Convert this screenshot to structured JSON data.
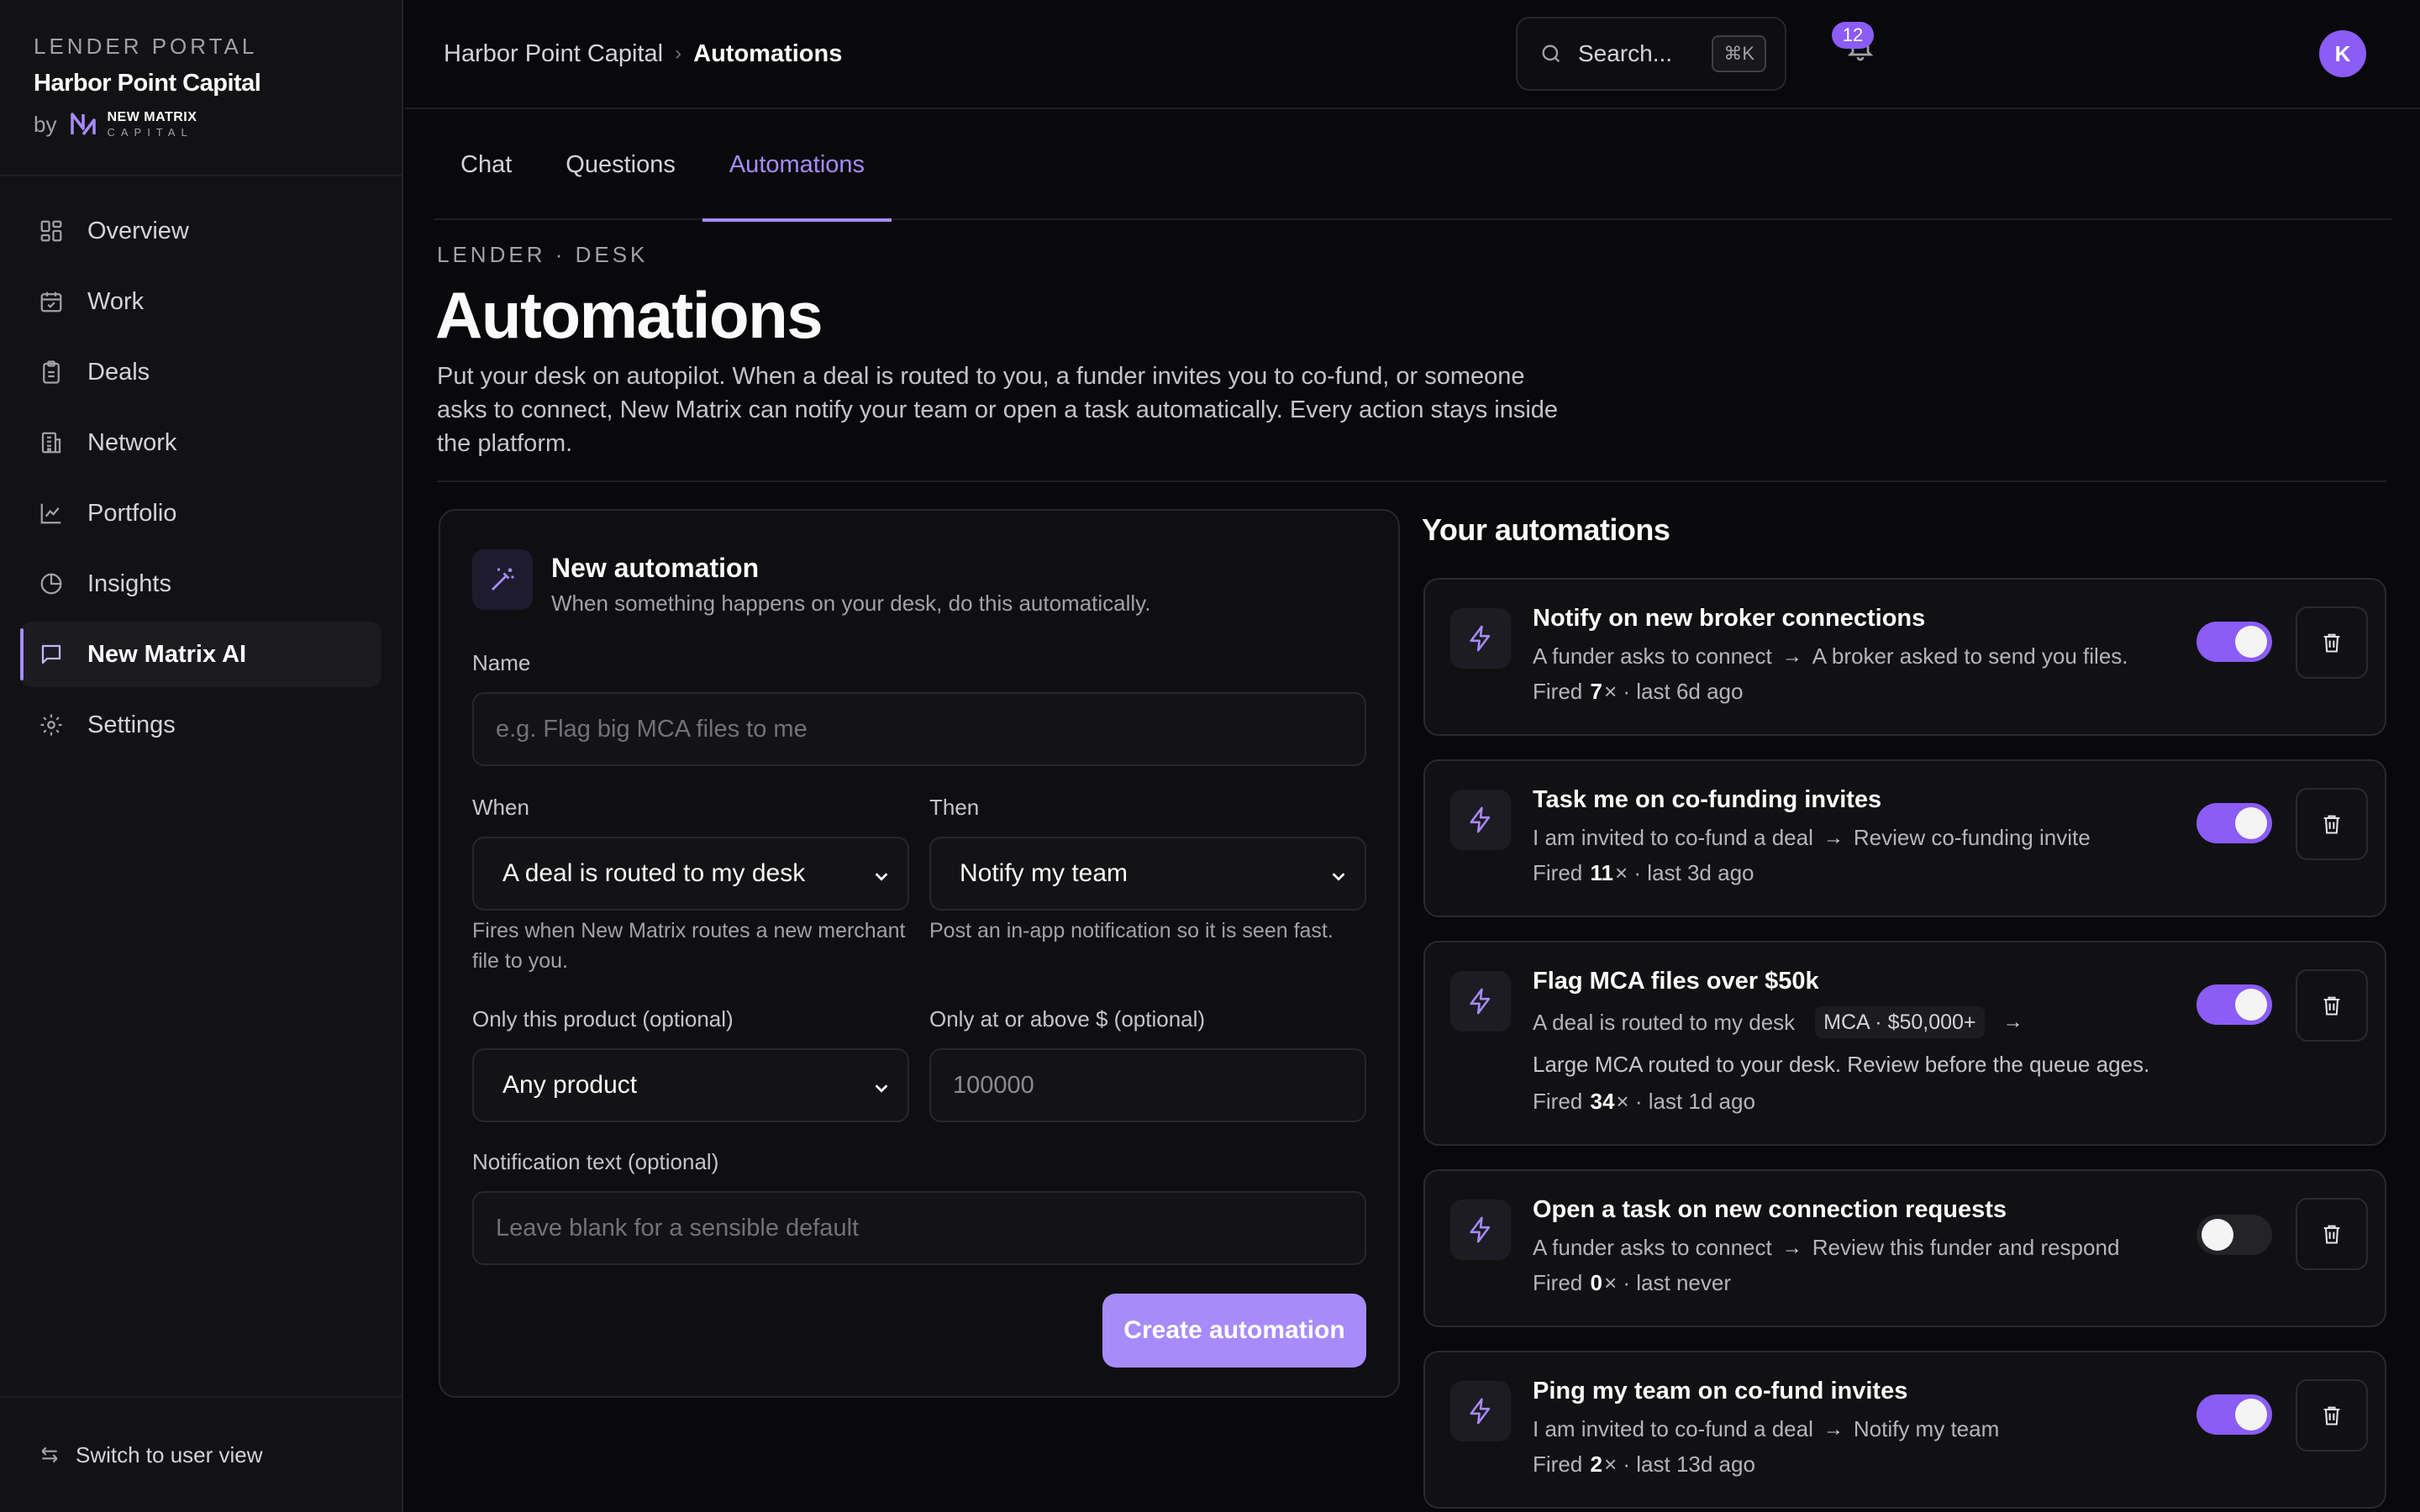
{
  "sidebar": {
    "eyebrow": "LENDER PORTAL",
    "org_name": "Harbor Point Capital",
    "by_label": "by",
    "logo_line1": "NEW MATRIX",
    "logo_line2": "CAPITAL",
    "items": [
      {
        "label": "Overview",
        "icon": "grid-icon"
      },
      {
        "label": "Work",
        "icon": "calendar-check-icon"
      },
      {
        "label": "Deals",
        "icon": "clipboard-icon"
      },
      {
        "label": "Network",
        "icon": "building-icon"
      },
      {
        "label": "Portfolio",
        "icon": "line-chart-icon"
      },
      {
        "label": "Insights",
        "icon": "pie-chart-icon"
      },
      {
        "label": "New Matrix AI",
        "icon": "chat-icon",
        "active": true
      },
      {
        "label": "Settings",
        "icon": "gear-icon"
      }
    ],
    "switch_view": "Switch to user view"
  },
  "topbar": {
    "breadcrumb_root": "Harbor Point Capital",
    "breadcrumb_sep": "›",
    "breadcrumb_current": "Automations",
    "search_placeholder": "Search...",
    "search_shortcut": "⌘K",
    "notification_count": "12",
    "avatar_initial": "K"
  },
  "tabs": [
    {
      "label": "Chat"
    },
    {
      "label": "Questions"
    },
    {
      "label": "Automations",
      "active": true
    }
  ],
  "header": {
    "eyebrow": "LENDER · DESK",
    "title": "Automations",
    "description": "Put your desk on autopilot. When a deal is routed to you, a funder invites you to co-fund, or someone asks to connect, New Matrix can notify your team or open a task automatically. Every action stays inside the platform."
  },
  "new_automation": {
    "title": "New automation",
    "subtitle": "When something happens on your desk, do this automatically.",
    "name_label": "Name",
    "name_placeholder": "e.g. Flag big MCA files to me",
    "when_label": "When",
    "when_value": "A deal is routed to my desk",
    "when_help": "Fires when New Matrix routes a new merchant file to you.",
    "then_label": "Then",
    "then_value": "Notify my team",
    "then_help": "Post an in-app notification so it is seen fast.",
    "product_label": "Only this product (optional)",
    "product_value": "Any product",
    "amount_label": "Only at or above $ (optional)",
    "amount_placeholder": "100000",
    "notification_label": "Notification text (optional)",
    "notification_placeholder": "Leave blank for a sensible default",
    "create_label": "Create automation"
  },
  "automations": {
    "title": "Your automations",
    "fired_prefix": "Fired",
    "fired_suffix": "×",
    "items": [
      {
        "name": "Notify on new broker connections",
        "trigger": "A funder asks to connect",
        "arrow": "→",
        "action": "A broker asked to send you files.",
        "fired": "7",
        "last": "· last 6d ago",
        "enabled": true
      },
      {
        "name": "Task me on co-funding invites",
        "trigger": "I am invited to co-fund a deal",
        "arrow": "→",
        "action": "Review co-funding invite",
        "fired": "11",
        "last": "· last 3d ago",
        "enabled": true
      },
      {
        "name": "Flag MCA files over $50k",
        "trigger": "A deal is routed to my desk",
        "chip": "MCA · $50,000+",
        "arrow": "→",
        "note": "Large MCA routed to your desk. Review before the queue ages.",
        "fired": "34",
        "last": "· last 1d ago",
        "enabled": true
      },
      {
        "name": "Open a task on new connection requests",
        "trigger": "A funder asks to connect",
        "arrow": "→",
        "action": "Review this funder and respond",
        "fired": "0",
        "last": "· last never",
        "enabled": false
      },
      {
        "name": "Ping my team on co-fund invites",
        "trigger": "I am invited to co-fund a deal",
        "arrow": "→",
        "action": "Notify my team",
        "fired": "2",
        "last": "· last 13d ago",
        "enabled": true
      }
    ]
  },
  "colors": {
    "accent": "#a78bfa",
    "accent_strong": "#8b5cf6",
    "background": "#09090b"
  }
}
